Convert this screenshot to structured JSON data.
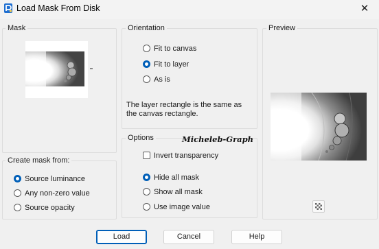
{
  "window": {
    "title": "Load Mask From Disk",
    "close_glyph": "✕",
    "app_icon": "paintshop-pro-icon"
  },
  "mask": {
    "legend": "Mask"
  },
  "orientation": {
    "legend": "Orientation",
    "options": [
      {
        "label": "Fit to canvas",
        "selected": false
      },
      {
        "label": "Fit to layer",
        "selected": true
      },
      {
        "label": "As is",
        "selected": false
      }
    ],
    "description": "The layer rectangle is the same as the canvas rectangle."
  },
  "preview": {
    "legend": "Preview",
    "toggle_icon": "checkerboard-icon"
  },
  "create_mask": {
    "legend": "Create mask from:",
    "options": [
      {
        "label": "Source luminance",
        "selected": true
      },
      {
        "label": "Any non-zero value",
        "selected": false
      },
      {
        "label": "Source opacity",
        "selected": false
      }
    ]
  },
  "options": {
    "legend": "Options",
    "invert_label": "Invert transparency",
    "invert_checked": false,
    "radios": [
      {
        "label": "Hide all mask",
        "selected": true
      },
      {
        "label": "Show all mask",
        "selected": false
      },
      {
        "label": "Use image value",
        "selected": false
      }
    ]
  },
  "watermark": "Micheleb-Graph",
  "buttons": {
    "load": "Load",
    "cancel": "Cancel",
    "help": "Help"
  },
  "colors": {
    "accent": "#005fb8",
    "background": "#f0f0f0"
  }
}
